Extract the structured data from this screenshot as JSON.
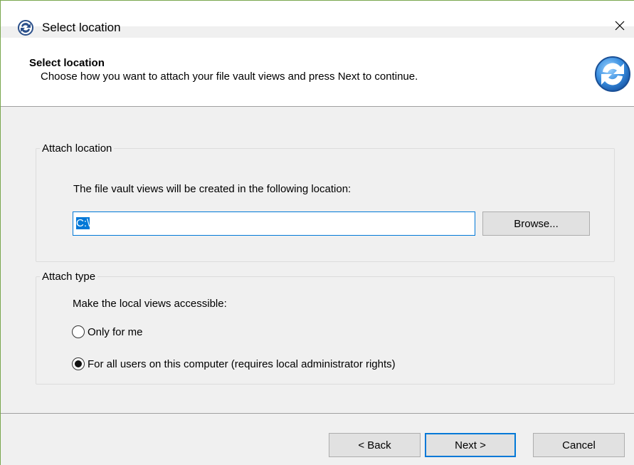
{
  "window": {
    "title": "Select location"
  },
  "header": {
    "title": "Select location",
    "subtitle": "Choose how you want to attach your file vault views and press Next to continue."
  },
  "attach_location": {
    "legend": "Attach location",
    "description": "The file vault views will be created in the following location:",
    "path_value": "C:\\",
    "browse_label": "Browse..."
  },
  "attach_type": {
    "legend": "Attach type",
    "description": "Make the local views accessible:",
    "options": [
      {
        "label": "Only for me",
        "checked": false
      },
      {
        "label": "For all users on this computer (requires local administrator rights)",
        "checked": true
      }
    ]
  },
  "footer": {
    "back_label": "< Back",
    "next_label": "Next >",
    "cancel_label": "Cancel"
  },
  "colors": {
    "accent": "#0078d7",
    "window_border": "#7aa74f"
  }
}
